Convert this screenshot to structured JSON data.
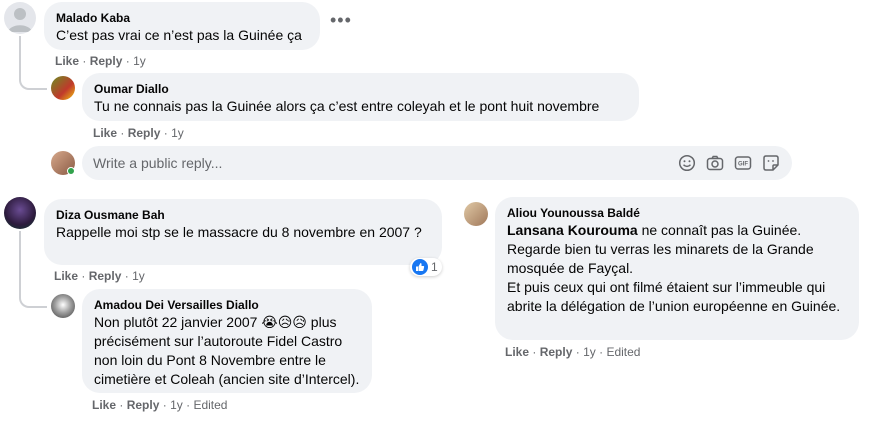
{
  "comments": {
    "malado": {
      "author": "Malado Kaba",
      "text": "C’est pas vrai ce n’est pas la Guinée ça",
      "like": "Like",
      "reply": "Reply",
      "time": "1y"
    },
    "oumar": {
      "author": "Oumar Diallo",
      "text": "Tu ne connais pas la Guinée alors ça c’est entre coleyah et le pont huit novembre",
      "like": "Like",
      "reply": "Reply",
      "time": "1y"
    },
    "diza": {
      "author": "Diza Ousmane Bah",
      "text": "Rappelle moi stp se le massacre du 8 novembre en 2007 ?",
      "like": "Like",
      "reply": "Reply",
      "time": "1y",
      "reaction_count": "1"
    },
    "amadou": {
      "author": "Amadou Dei Versailles Diallo",
      "text_before": "Non plutôt 22 janvier 2007 ",
      "emojis": "😭😥😥",
      "text_after": " plus précisément sur l’autoroute Fidel Castro non loin du Pont 8 Novembre entre le cimetière et Coleah (ancien site d’Intercel).",
      "like": "Like",
      "reply": "Reply",
      "time": "1y",
      "edited": "Edited"
    },
    "aliou": {
      "author": "Aliou Younoussa Baldé",
      "mention": "Lansana Kourouma",
      "text_1": " ne connaît pas la Guinée.",
      "text_2": "Regarde bien tu verras les minarets de la Grande mosquée de Fayçal.",
      "text_3": "Et puis ceux qui ont filmé étaient sur l’immeuble qui abrite la délégation de l’union européenne en Guinée.",
      "like": "Like",
      "reply": "Reply",
      "time": "1y",
      "edited": "Edited"
    }
  },
  "reply_box": {
    "placeholder": "Write a public reply..."
  },
  "separator": "·",
  "colors": {
    "bubble": "#f0f2f5",
    "meta": "#65676b",
    "like_blue": "#1877f2",
    "online": "#31a24c"
  }
}
